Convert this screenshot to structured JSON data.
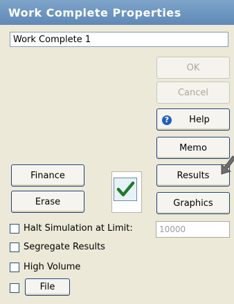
{
  "window": {
    "title": "Work Complete Properties"
  },
  "name_field": {
    "value": "Work Complete 1"
  },
  "buttons": {
    "ok": "OK",
    "cancel": "Cancel",
    "help": "Help",
    "memo": "Memo",
    "results": "Results",
    "graphics": "Graphics",
    "finance": "Finance",
    "erase": "Erase",
    "file": "File"
  },
  "options": {
    "halt_simulation_label": "Halt Simulation at Limit:",
    "halt_limit_value": "10000",
    "segregate_results_label": "Segregate Results",
    "high_volume_label": "High Volume"
  },
  "icons": {
    "help": "help-icon",
    "check": "checkmark-icon",
    "cursor": "mouse-cursor-icon"
  }
}
